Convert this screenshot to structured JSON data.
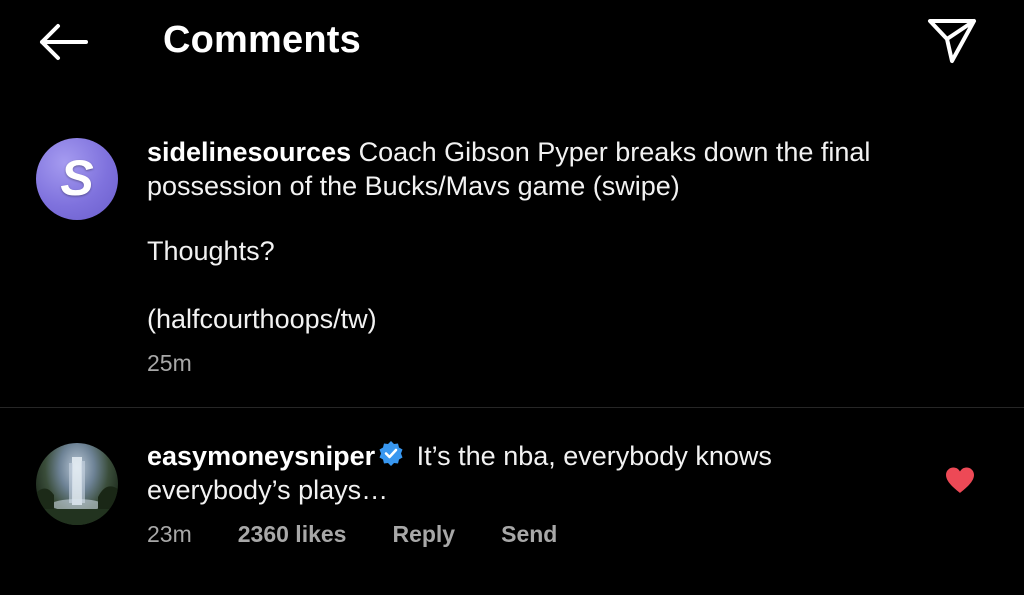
{
  "header": {
    "title": "Comments",
    "back_icon": "arrow-left-icon",
    "send_icon": "paper-plane-icon"
  },
  "caption": {
    "avatar_letter": "S",
    "username": "sidelinesources",
    "text_line1": "Coach Gibson Pyper breaks down the final possession of the Bucks/Mavs game (swipe)",
    "text_line2": "Thoughts?",
    "text_line3": "(halfcourthoops/tw)",
    "time": "25m"
  },
  "comment": {
    "username": "easymoneysniper",
    "verified": true,
    "text": "It’s the nba, everybody knows everybody’s plays…",
    "time": "23m",
    "likes": "2360 likes",
    "reply_label": "Reply",
    "send_label": "Send",
    "liked": true
  },
  "colors": {
    "background": "#000000",
    "verified_badge": "#3897f0",
    "heart": "#ed4956",
    "avatar_purple": "#7f72dd",
    "meta_text": "#a8a8a8"
  }
}
